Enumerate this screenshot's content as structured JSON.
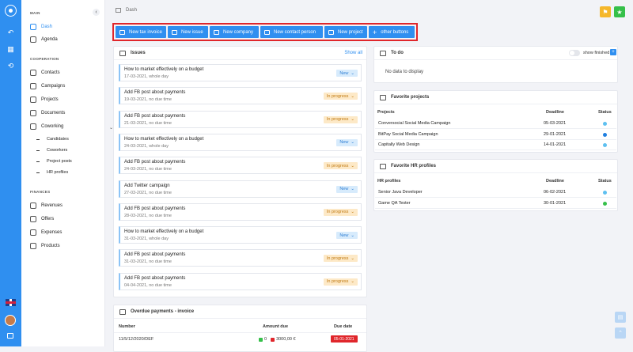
{
  "sidebar": {
    "main_title": "MAIN",
    "main_items": [
      "Dash",
      "Agenda"
    ],
    "coop_title": "COOPERATION",
    "coop_items": [
      "Contacts",
      "Campaigns",
      "Projects",
      "Documents",
      "Coworking"
    ],
    "cowork_items": [
      "Candidates",
      "Coworkers",
      "Project posts",
      "HR profiles"
    ],
    "fin_title": "FINANCES",
    "fin_items": [
      "Revenues",
      "Offers",
      "Expenses",
      "Products"
    ]
  },
  "breadcrumb": "Dash",
  "quick_buttons": [
    "New tax invoice",
    "New issue",
    "New company",
    "New contact person",
    "New project",
    "other buttons"
  ],
  "colors": {
    "accent": "#2f8ff0",
    "highlight": "#e0262b",
    "flag_btn": "#f5b72b",
    "star_btn": "#36c04a",
    "in_progress": "#fde9c7",
    "new": "#d7ebfc"
  },
  "issues": {
    "title": "Issues",
    "show_all": "Show all",
    "items": [
      {
        "title": "How to market effectively on a budget",
        "date": "17-03-2021, whole day",
        "status": "New",
        "kind": "new"
      },
      {
        "title": "Add FB post about payments",
        "date": "19-03-2021, no due time",
        "status": "In progress",
        "kind": "prog"
      },
      {
        "title": "Add FB post about payments",
        "date": "21-03-2021, no due time",
        "status": "In progress",
        "kind": "prog"
      },
      {
        "title": "How to market effectively on a budget",
        "date": "24-03-2021, whole day",
        "status": "New",
        "kind": "new"
      },
      {
        "title": "Add FB post about payments",
        "date": "24-03-2021, no due time",
        "status": "In progress",
        "kind": "prog"
      },
      {
        "title": "Add Twitter campaign",
        "date": "27-03-2021, no due time",
        "status": "New",
        "kind": "new"
      },
      {
        "title": "Add FB post about payments",
        "date": "28-03-2021, no due time",
        "status": "In progress",
        "kind": "prog"
      },
      {
        "title": "How to market effectively on a budget",
        "date": "31-03-2021, whole day",
        "status": "New",
        "kind": "new"
      },
      {
        "title": "Add FB post about payments",
        "date": "31-03-2021, no due time",
        "status": "In progress",
        "kind": "prog"
      },
      {
        "title": "Add FB post about payments",
        "date": "04-04-2021, no due time",
        "status": "In progress",
        "kind": "prog"
      }
    ]
  },
  "overdue": {
    "title": "Overdue payments - invoice",
    "col_number": "Number",
    "col_amount": "Amount due",
    "col_due": "Due date",
    "number": "11/5/12/2020/DEF",
    "amount_a": "0",
    "amount_b": "3000,00 €",
    "due": "05-01-2021"
  },
  "todo": {
    "title": "To do",
    "show_finished": "show finished",
    "empty": "No data to display"
  },
  "fav_projects": {
    "title": "Favorite projects",
    "col_name": "Projects",
    "col_deadline": "Deadline",
    "col_status": "Status",
    "rows": [
      {
        "name": "Conversocial Social Media Campaign",
        "deadline": "05-03-2021",
        "color": "#5ec0f0"
      },
      {
        "name": "BitPay Social Media Campaign",
        "deadline": "29-01-2021",
        "color": "#1f7fe0"
      },
      {
        "name": "Capitally Web Design",
        "deadline": "14-01-2021",
        "color": "#5ec0f0"
      }
    ]
  },
  "fav_hr": {
    "title": "Favorite HR profiles",
    "col_name": "HR profiles",
    "col_deadline": "Deadline",
    "col_status": "Status",
    "rows": [
      {
        "name": "Senior Java Developer",
        "deadline": "06-02-2021",
        "color": "#5ec0f0"
      },
      {
        "name": "Game QA Tester",
        "deadline": "30-01-2021",
        "color": "#36c04a"
      }
    ]
  }
}
